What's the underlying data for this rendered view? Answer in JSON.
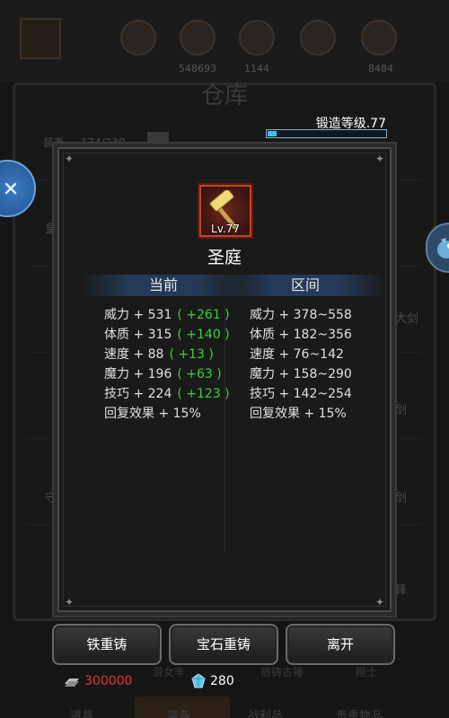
{
  "background": {
    "title": "仓库",
    "count_label": "装备",
    "count_value": "174/230",
    "resources": [
      "548693",
      "1144",
      "8484"
    ],
    "side_labels": [
      "皇",
      "大剑",
      "剑",
      "守",
      "剑",
      "锋"
    ],
    "sub_labels": [
      "游女丰",
      "宿铸古锤",
      "瞪士"
    ],
    "tabs": [
      "道具",
      "装备",
      "战利品",
      "贵重物品"
    ]
  },
  "forge": {
    "label": "锻造等级.77",
    "progress": 0.08
  },
  "item": {
    "level": "Lv.77",
    "name": "圣庭"
  },
  "columns": {
    "current": "当前",
    "range": "区间"
  },
  "current_stats": [
    {
      "label": "威力 + 531",
      "bonus": "( +261 )"
    },
    {
      "label": "体质 + 315",
      "bonus": "( +140 )"
    },
    {
      "label": "速度 + 88",
      "bonus": "( +13 )"
    },
    {
      "label": "魔力 + 196",
      "bonus": "( +63 )"
    },
    {
      "label": "技巧 + 224",
      "bonus": "( +123 )"
    },
    {
      "label": "回复效果 + 15%",
      "bonus": ""
    }
  ],
  "range_stats": [
    "威力 + 378~558",
    "体质 + 182~356",
    "速度 + 76~142",
    "魔力 + 158~290",
    "技巧 + 142~254",
    "回复效果 + 15%"
  ],
  "buttons": {
    "iron_reforge": "铁重铸",
    "gem_reforge": "宝石重铸",
    "leave": "离开"
  },
  "currency": {
    "silver": "300000",
    "gem": "280"
  },
  "colors": {
    "bonus_green": "#35d435",
    "silver_red": "#e23a3a",
    "forge_bar": "#3ec3e8",
    "header_band": "#243a58"
  }
}
